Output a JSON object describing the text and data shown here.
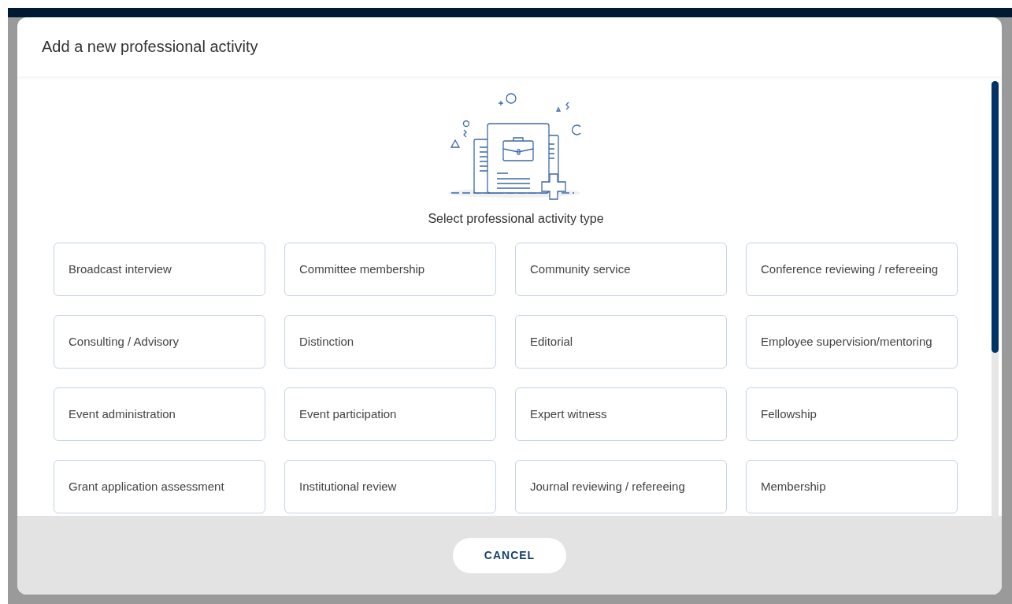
{
  "dialog": {
    "title": "Add a new professional activity",
    "prompt": "Select professional activity type",
    "activity_types": [
      {
        "label": "Broadcast interview"
      },
      {
        "label": "Committee membership"
      },
      {
        "label": "Community service"
      },
      {
        "label": "Conference reviewing / refereeing"
      },
      {
        "label": "Consulting / Advisory"
      },
      {
        "label": "Distinction"
      },
      {
        "label": "Editorial"
      },
      {
        "label": "Employee supervision/mentoring"
      },
      {
        "label": "Event administration"
      },
      {
        "label": "Event participation"
      },
      {
        "label": "Expert witness"
      },
      {
        "label": "Fellowship"
      },
      {
        "label": "Grant application assessment"
      },
      {
        "label": "Institutional review"
      },
      {
        "label": "Journal reviewing / refereeing"
      },
      {
        "label": "Membership"
      }
    ],
    "buttons": [
      {
        "label": "CANCEL"
      }
    ]
  }
}
